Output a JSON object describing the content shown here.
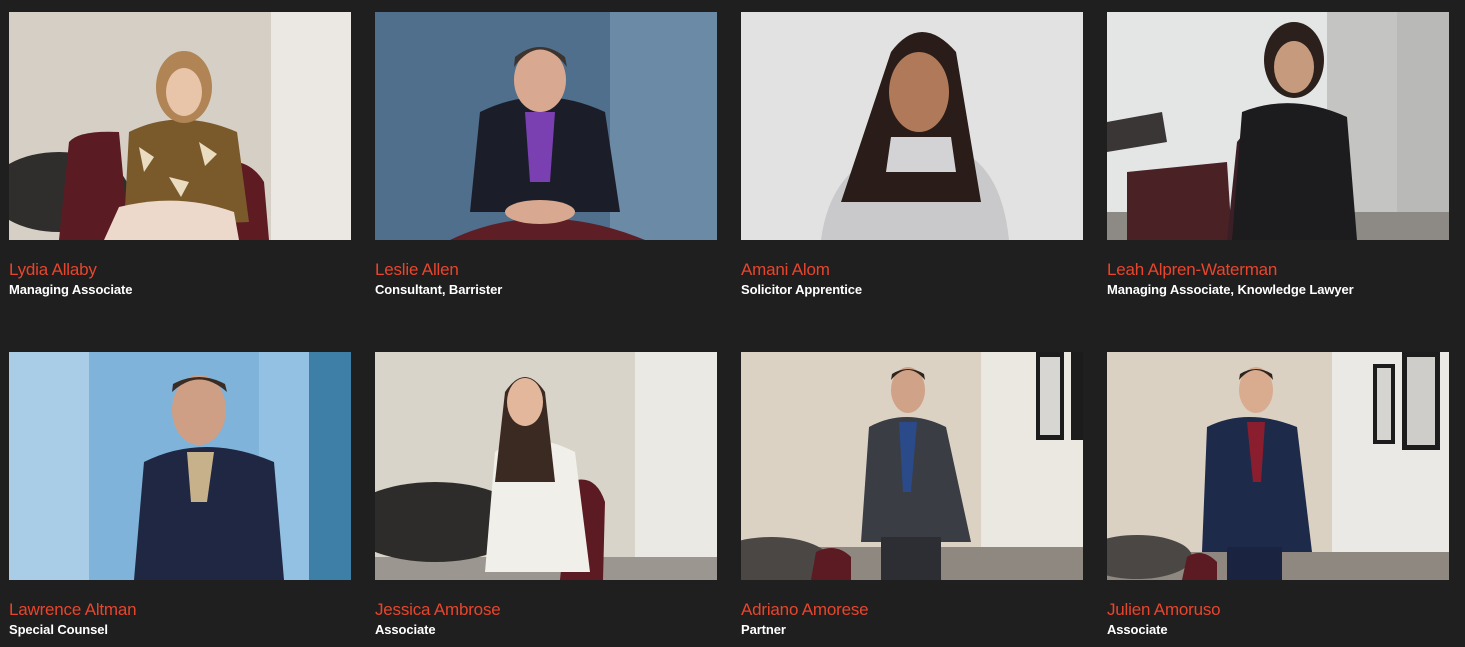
{
  "people": [
    {
      "name": "Lydia Allaby",
      "role": "Managing Associate",
      "photo_icon": "portrait-photo"
    },
    {
      "name": "Leslie Allen",
      "role": "Consultant, Barrister",
      "photo_icon": "portrait-photo"
    },
    {
      "name": "Amani Alom",
      "role": "Solicitor Apprentice",
      "photo_icon": "portrait-photo"
    },
    {
      "name": "Leah Alpren-Waterman",
      "role": "Managing Associate, Knowledge Lawyer",
      "photo_icon": "portrait-photo"
    },
    {
      "name": "Lawrence Altman",
      "role": "Special Counsel",
      "photo_icon": "portrait-photo"
    },
    {
      "name": "Jessica Ambrose",
      "role": "Associate",
      "photo_icon": "portrait-photo"
    },
    {
      "name": "Adriano Amorese",
      "role": "Partner",
      "photo_icon": "portrait-photo"
    },
    {
      "name": "Julien Amoruso",
      "role": "Associate",
      "photo_icon": "portrait-photo"
    }
  ],
  "colors": {
    "background": "#1f1f1f",
    "name": "#e8452c",
    "role": "#ffffff"
  }
}
